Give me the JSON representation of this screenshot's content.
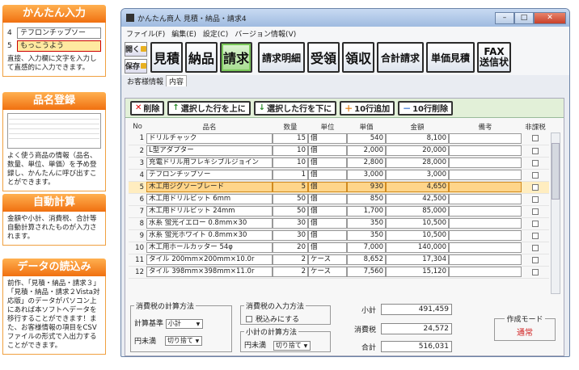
{
  "promo": {
    "input": {
      "title": "かんたん入力",
      "rows": [
        {
          "no": "4",
          "text": "テフロンチップソー"
        },
        {
          "no": "5",
          "text": "もっこうよう"
        }
      ],
      "desc": "直接、入力欄に文字を入力して直感的に入力できます。"
    },
    "items": {
      "title": "品名登録",
      "desc": "よく使う商品の情報（品名、数量、単位、単価）を予め登録し、かんたんに呼び出すことができます。"
    },
    "calc": {
      "title": "自動計算",
      "desc": "金額や小計、消費税、合計等自動計算されたものが入力されます。"
    },
    "import": {
      "title": "データの読込み",
      "desc": "前作、「見積・納品・請求３」「見積・納品・請求２Vista対応版」のデータがパソコン上にあれば本ソフトへデータを移行することができます！また、お客様情報の項目をCSVファイルの形式で入出力することができます。"
    }
  },
  "window": {
    "title": "かんたん商人 見積・納品・請求4",
    "menu": [
      "ファイル(F)",
      "編集(E)",
      "設定(C)",
      "バージョン情報(V)"
    ],
    "small_buttons": [
      "開く",
      "保存"
    ],
    "big_buttons": [
      "見積",
      "納品",
      "請求",
      "請求明細",
      "受領",
      "領収",
      "合計請求",
      "単価見積"
    ],
    "fax_button": [
      "FAX",
      "送信状"
    ],
    "tabs": [
      "お客様情報",
      "内容"
    ],
    "actions": [
      "削除",
      "選択した行を上に",
      "選択した行を下に",
      "10行追加",
      "10行削除"
    ],
    "columns": [
      "No",
      "品名",
      "数量",
      "単位",
      "単価",
      "金額",
      "備考",
      "非課税"
    ],
    "rows": [
      {
        "no": "1",
        "name": "ドリルチャック",
        "qty": "15",
        "unit": "個",
        "price": "540",
        "amount": "8,100"
      },
      {
        "no": "2",
        "name": "L型アダプター",
        "qty": "10",
        "unit": "個",
        "price": "2,000",
        "amount": "20,000"
      },
      {
        "no": "3",
        "name": "充電ドリル用フレキシブルジョイン",
        "qty": "10",
        "unit": "個",
        "price": "2,800",
        "amount": "28,000"
      },
      {
        "no": "4",
        "name": "テフロンチップソー",
        "qty": "1",
        "unit": "個",
        "price": "3,000",
        "amount": "3,000"
      },
      {
        "no": "5",
        "name": "木工用ジグソーブレード",
        "qty": "5",
        "unit": "個",
        "price": "930",
        "amount": "4,650",
        "selected": true
      },
      {
        "no": "6",
        "name": "木工用ドリルビット 6mm",
        "qty": "50",
        "unit": "個",
        "price": "850",
        "amount": "42,500"
      },
      {
        "no": "7",
        "name": "木工用ドリルビット 24mm",
        "qty": "50",
        "unit": "個",
        "price": "1,700",
        "amount": "85,000"
      },
      {
        "no": "8",
        "name": "水糸 蛍光イエロー 0.8mm×30",
        "qty": "30",
        "unit": "個",
        "price": "350",
        "amount": "10,500"
      },
      {
        "no": "9",
        "name": "水糸 蛍光ホワイト 0.8mm×30",
        "qty": "30",
        "unit": "個",
        "price": "350",
        "amount": "10,500"
      },
      {
        "no": "10",
        "name": "木工用ホールカッター 54φ",
        "qty": "20",
        "unit": "個",
        "price": "7,000",
        "amount": "140,000"
      },
      {
        "no": "11",
        "name": "タイル 200mm×200mm×10.0r",
        "qty": "2",
        "unit": "ケース",
        "price": "8,652",
        "amount": "17,304"
      },
      {
        "no": "12",
        "name": "タイル 398mm×398mm×11.0r",
        "qty": "2",
        "unit": "ケース",
        "price": "7,560",
        "amount": "15,120"
      }
    ],
    "tax_calc": {
      "legend": "消費税の計算方法",
      "base_label": "計算基準",
      "base_value": "小計",
      "round_label": "円未満",
      "round_value": "切り捨て"
    },
    "tax_input": {
      "legend": "消費税の入力方法",
      "checkbox_label": "税込みにする"
    },
    "subtotal_calc": {
      "legend": "小計の計算方法",
      "round_label": "円未満",
      "round_value": "切り捨て"
    },
    "summary": {
      "subtotal_label": "小計",
      "subtotal": "491,459",
      "tax_label": "消費税",
      "tax": "24,572",
      "total_label": "合計",
      "total": "516,031"
    },
    "mode": {
      "legend": "作成モード",
      "value": "通常"
    }
  }
}
